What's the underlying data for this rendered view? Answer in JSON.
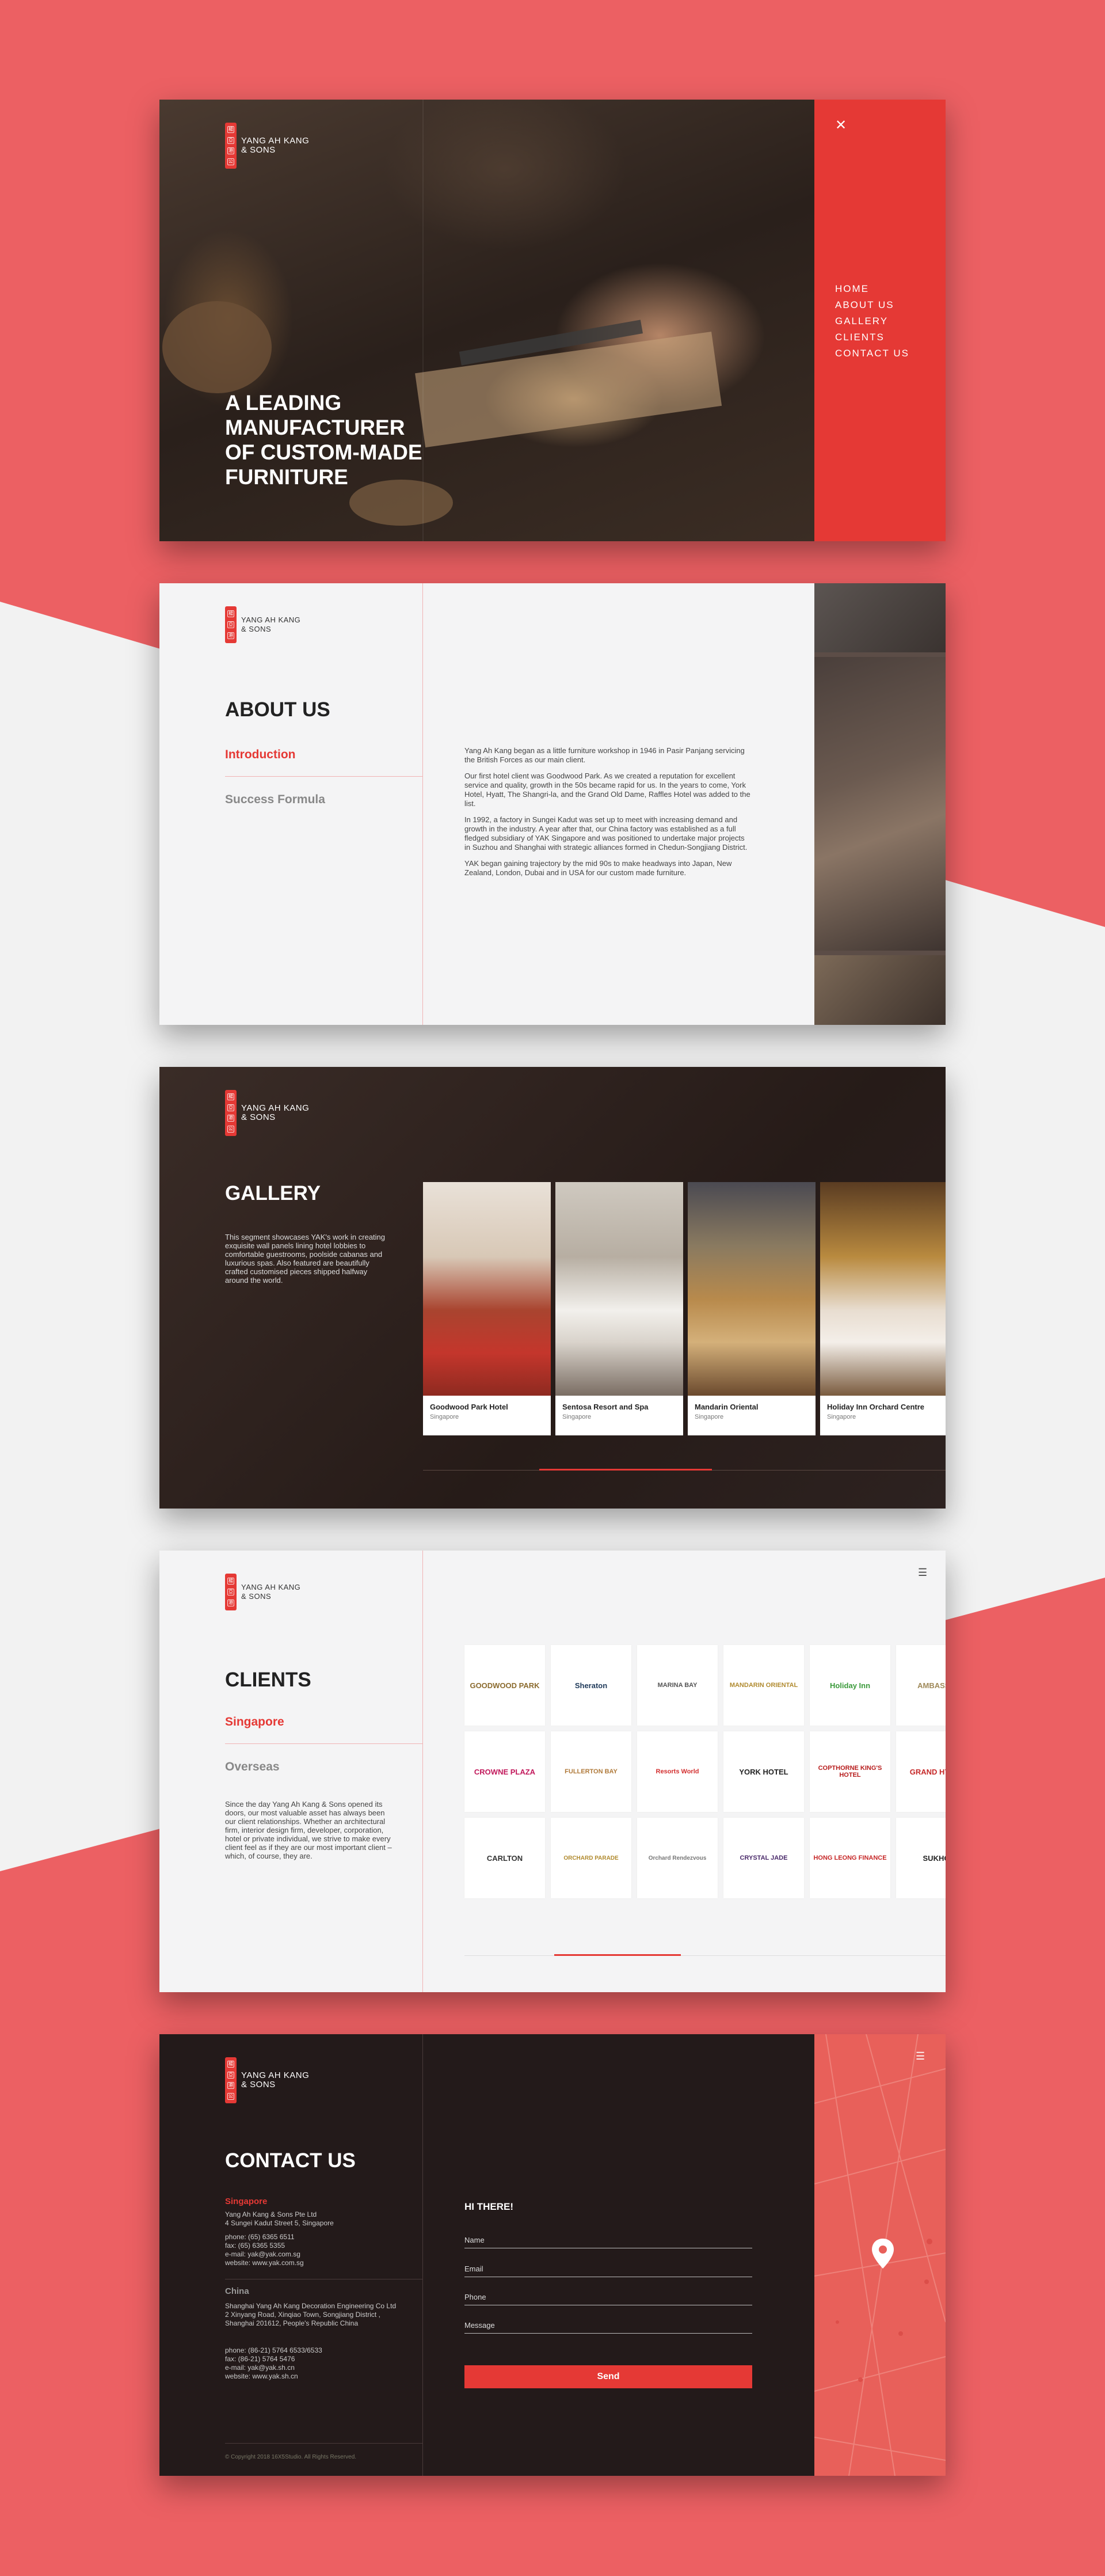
{
  "brand": {
    "name_line1": "YANG AH KANG",
    "name_line2": "& SONS",
    "seal_glyphs": [
      "楊",
      "亞",
      "港",
      "公",
      "司"
    ],
    "accent": "#e53935",
    "background": "#ec6063"
  },
  "hero": {
    "title": "A LEADING MANUFACTURER OF CUSTOM-MADE FURNITURE",
    "close_icon": "close-icon",
    "menu": [
      "HOME",
      "ABOUT US",
      "GALLERY",
      "CLIENTS",
      "CONTACT US"
    ]
  },
  "about": {
    "title": "ABOUT US",
    "tabs": [
      "Introduction",
      "Success Formula"
    ],
    "paragraphs": [
      "Yang Ah Kang began as a little furniture workshop in 1946 in Pasir Panjang servicing the British Forces as our main client.",
      "Our first hotel client was Goodwood Park. As we created a reputation for excellent service and quality, growth in the 50s became rapid for us. In the years to come, York Hotel, Hyatt, The Shangri-la, and the Grand Old Dame, Raffles Hotel was added to the list.",
      "In 1992, a factory in Sungei Kadut was set up to meet with increasing demand and growth in the industry. A year after that, our China factory was established as a full fledged subsidiary of YAK Singapore and was positioned to undertake major projects in Suzhou and Shanghai with strategic alliances formed in Chedun-Songjiang District.",
      "YAK began gaining trajectory by the mid 90s to make headways into Japan, New Zealand, London, Dubai and in USA for our custom made furniture."
    ]
  },
  "gallery": {
    "title": "GALLERY",
    "description": "This segment showcases YAK's work in creating exquisite wall panels lining hotel lobbies to comfortable guestrooms, poolside cabanas and luxurious spas. Also featured are beautifully crafted customised pieces shipped halfway around the world.",
    "cards": [
      {
        "name": "Goodwood Park Hotel",
        "location": "Singapore"
      },
      {
        "name": "Sentosa Resort and Spa",
        "location": "Singapore"
      },
      {
        "name": "Mandarin Oriental",
        "location": "Singapore"
      },
      {
        "name": "Holiday Inn Orchard Centre",
        "location": "Singapore"
      }
    ]
  },
  "clients": {
    "title": "CLIENTS",
    "tabs": [
      "Singapore",
      "Overseas"
    ],
    "description": "Since the day Yang Ah Kang & Sons opened its doors, our most valuable asset has always been our client relationships. Whether an architectural firm, interior design firm, developer, corporation, hotel or private individual, we strive to make every client feel as if they are our most important client – which, of course, they are.",
    "menu_icon": "hamburger-icon",
    "logos": [
      [
        "GOODWOOD PARK",
        "Sheraton",
        "MARINA BAY",
        "MANDARIN ORIENTAL",
        "Holiday Inn",
        "AMBASSA"
      ],
      [
        "CROWNE PLAZA",
        "FULLERTON BAY",
        "Resorts World",
        "YORK HOTEL",
        "COPTHORNE KING'S HOTEL",
        "GRAND HYATT"
      ],
      [
        "CARLTON",
        "ORCHARD PARADE",
        "Orchard Rendezvous",
        "CRYSTAL JADE",
        "HONG LEONG FINANCE",
        "SUKHO"
      ]
    ]
  },
  "contact": {
    "title": "CONTACT US",
    "singapore": {
      "heading": "Singapore",
      "address": "Yang Ah Kang & Sons Pte Ltd\n4 Sungei Kadut Street 5, Singapore",
      "details": "phone: (65) 6365 6511\nfax: (65) 6365 5355\ne-mail: yak@yak.com.sg\nwebsite: www.yak.com.sg"
    },
    "china": {
      "heading": "China",
      "address": "Shanghai Yang Ah Kang Decoration Engineering Co Ltd\n2 Xinyang Road, Xinqiao Town, Songjiang District , Shanghai 201612, People's Republic China",
      "details": "phone: (86-21) 5764 6533/6533\nfax: (86-21) 5764 5476\ne-mail: yak@yak.sh.cn\nwebsite: www.yak.sh.cn"
    },
    "copyright": "© Copyright 2018 16X5Studio. All Rights Reserved.",
    "form": {
      "greeting": "HI THERE!",
      "name": "Name",
      "email": "Email",
      "phone": "Phone",
      "message": "Message",
      "send": "Send"
    },
    "map_icon": "map-pin-icon"
  }
}
